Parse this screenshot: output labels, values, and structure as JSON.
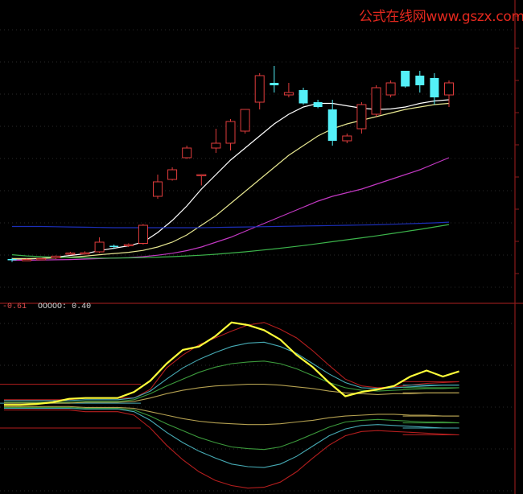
{
  "watermark": {
    "text": "公式在线网www.gszx.com.cn",
    "color": "#e3281e"
  },
  "indicator": {
    "value_1": "-0.61",
    "name": "OOOOO:",
    "value_2": "0.40"
  },
  "colors": {
    "background": "#000000",
    "up_candle": "#e03c3c",
    "down_candle": "#54f0f8",
    "frame": "#8b1a1a",
    "ma_white": "#ffffff",
    "ma_yellow": "#e6e690",
    "ma_magenta": "#c238c2",
    "ma_green": "#3cb44b",
    "ma_blue": "#1c2fb8",
    "osc_main": "#ffff3a",
    "band_red": "#b41e1e",
    "band_cyan": "#46aab4",
    "band_green": "#3c9a3c",
    "band_tan": "#b4a050"
  },
  "chart_data": [
    {
      "type": "candlestick",
      "panel": "price",
      "candles": [
        {
          "o": 6.0,
          "h": 6.5,
          "l": 4.8,
          "c": 5.5
        },
        {
          "o": 5.6,
          "h": 6.2,
          "l": 5.2,
          "c": 5.8
        },
        {
          "o": 5.8,
          "h": 6.4,
          "l": 5.5,
          "c": 6.2
        },
        {
          "o": 6.5,
          "h": 7.5,
          "l": 6.0,
          "c": 7.2
        },
        {
          "o": 8.5,
          "h": 9.0,
          "l": 7.8,
          "c": 8.5
        },
        {
          "o": 8.5,
          "h": 9.2,
          "l": 8.0,
          "c": 8.6
        },
        {
          "o": 9.0,
          "h": 15.0,
          "l": 8.5,
          "c": 13.0
        },
        {
          "o": 11.5,
          "h": 12.0,
          "l": 10.2,
          "c": 11.0
        },
        {
          "o": 11.5,
          "h": 12.5,
          "l": 11.0,
          "c": 12.0
        },
        {
          "o": 12.5,
          "h": 20.5,
          "l": 12.0,
          "c": 20.0
        },
        {
          "o": 32.0,
          "h": 41.0,
          "l": 31.0,
          "c": 38.0
        },
        {
          "o": 39.0,
          "h": 44.0,
          "l": 38.5,
          "c": 43.0
        },
        {
          "o": 48.0,
          "h": 53.0,
          "l": 47.5,
          "c": 52.0
        },
        {
          "o": 41.0,
          "h": 41.0,
          "l": 36.5,
          "c": 41.0
        },
        {
          "o": 52.0,
          "h": 60.0,
          "l": 50.0,
          "c": 54.0
        },
        {
          "o": 54.0,
          "h": 64.0,
          "l": 51.0,
          "c": 63.0
        },
        {
          "o": 59.0,
          "h": 65.0,
          "l": 58.0,
          "c": 68.0
        },
        {
          "o": 71.0,
          "h": 83.0,
          "l": 68.0,
          "c": 82.0
        },
        {
          "o": 79.0,
          "h": 86.0,
          "l": 75.0,
          "c": 78.0
        },
        {
          "o": 74.0,
          "h": 79.0,
          "l": 73.0,
          "c": 75.0
        },
        {
          "o": 76.0,
          "h": 77.0,
          "l": 70.0,
          "c": 70.5
        },
        {
          "o": 71.0,
          "h": 72.0,
          "l": 68.5,
          "c": 69.0
        },
        {
          "o": 68.0,
          "h": 72.0,
          "l": 53.0,
          "c": 55.0
        },
        {
          "o": 55.0,
          "h": 58.0,
          "l": 54.0,
          "c": 57.0
        },
        {
          "o": 60.0,
          "h": 71.0,
          "l": 58.0,
          "c": 70.0
        },
        {
          "o": 66.0,
          "h": 78.0,
          "l": 65.0,
          "c": 77.0
        },
        {
          "o": 74.0,
          "h": 80.0,
          "l": 73.0,
          "c": 79.0
        },
        {
          "o": 84.0,
          "h": 84.0,
          "l": 77.0,
          "c": 77.5
        },
        {
          "o": 82.0,
          "h": 84.0,
          "l": 75.0,
          "c": 78.0
        },
        {
          "o": 81.0,
          "h": 83.0,
          "l": 70.0,
          "c": 73.0
        },
        {
          "o": 74.0,
          "h": 80.0,
          "l": 69.0,
          "c": 79.0
        }
      ],
      "moving_averages": [
        {
          "color": "#ffffff",
          "values": [
            6,
            6,
            6.3,
            6.8,
            7.5,
            8.2,
            9.5,
            10.5,
            11.5,
            13,
            17,
            22,
            28,
            35,
            41,
            47,
            52,
            57,
            62,
            66,
            69,
            70.5,
            70.5,
            69.5,
            68.5,
            68,
            68.2,
            69,
            70.5,
            71.5,
            72
          ]
        },
        {
          "color": "#e6e690",
          "values": [
            6.2,
            6.2,
            6.3,
            6.5,
            6.8,
            7.2,
            7.8,
            8.3,
            8.8,
            9.6,
            11,
            13,
            16,
            20,
            24,
            29,
            34,
            39,
            44,
            49,
            53,
            57,
            60,
            62,
            63.5,
            65,
            66.5,
            68,
            69,
            70,
            70.5
          ]
        },
        {
          "color": "#c238c2",
          "values": [
            5.5,
            5.5,
            5.6,
            5.7,
            5.8,
            6,
            6.2,
            6.4,
            6.6,
            7,
            7.6,
            8.4,
            9.5,
            11,
            13,
            15,
            17.5,
            20,
            22.5,
            25,
            27.5,
            30,
            32,
            33.5,
            35,
            37,
            39,
            41,
            43,
            45.5,
            48
          ]
        },
        {
          "color": "#3cb44b",
          "values": [
            7.8,
            7.3,
            7,
            6.8,
            6.6,
            6.5,
            6.4,
            6.4,
            6.5,
            6.6,
            6.8,
            7,
            7.3,
            7.6,
            8,
            8.5,
            9,
            9.6,
            10.2,
            10.9,
            11.6,
            12.4,
            13.2,
            14,
            14.8,
            15.6,
            16.5,
            17.4,
            18.3,
            19.3,
            20.3
          ]
        },
        {
          "color": "#1c2fb8",
          "values": [
            19.5,
            19.5,
            19.5,
            19.4,
            19.3,
            19.2,
            19.1,
            19,
            19,
            19,
            19,
            19,
            19,
            19,
            19.1,
            19.2,
            19.3,
            19.4,
            19.5,
            19.6,
            19.7,
            19.8,
            19.9,
            20,
            20.1,
            20.2,
            20.4,
            20.6,
            20.8,
            21,
            21.3
          ]
        }
      ]
    },
    {
      "type": "line",
      "panel": "oscillator",
      "series": [
        {
          "role": "main",
          "color": "#ffff3a",
          "values": [
            -0.08,
            -0.08,
            -0.07,
            -0.05,
            -0.01,
            0.0,
            0.0,
            0.0,
            0.07,
            0.2,
            0.4,
            0.56,
            0.6,
            0.72,
            0.88,
            0.85,
            0.79,
            0.68,
            0.5,
            0.36,
            0.18,
            0.02,
            0.07,
            0.1,
            0.14,
            0.25,
            0.32,
            0.25,
            0.31
          ]
        },
        {
          "role": "band-upper",
          "color": "#b41e1e",
          "values": [
            -0.02,
            -0.02,
            -0.02,
            -0.02,
            -0.02,
            0.0,
            0.0,
            0.0,
            0.0,
            0.1,
            0.35,
            0.5,
            0.62,
            0.7,
            0.78,
            0.85,
            0.88,
            0.8,
            0.7,
            0.55,
            0.38,
            0.22,
            0.14,
            0.12,
            0.13,
            0.15,
            0.17,
            0.18,
            0.19
          ]
        },
        {
          "role": "band-upper",
          "color": "#46aab4",
          "values": [
            -0.03,
            -0.03,
            -0.03,
            -0.03,
            -0.03,
            -0.02,
            -0.02,
            -0.02,
            0.0,
            0.08,
            0.22,
            0.35,
            0.45,
            0.53,
            0.6,
            0.64,
            0.65,
            0.6,
            0.52,
            0.4,
            0.28,
            0.18,
            0.12,
            0.11,
            0.12,
            0.13,
            0.14,
            0.15,
            0.15
          ]
        },
        {
          "role": "band-upper",
          "color": "#3c9a3c",
          "values": [
            -0.05,
            -0.05,
            -0.05,
            -0.05,
            -0.05,
            -0.04,
            -0.04,
            -0.04,
            -0.02,
            0.05,
            0.14,
            0.22,
            0.3,
            0.36,
            0.4,
            0.42,
            0.43,
            0.4,
            0.34,
            0.26,
            0.18,
            0.12,
            0.09,
            0.08,
            0.09,
            0.1,
            0.11,
            0.11,
            0.12
          ]
        },
        {
          "role": "band-upper",
          "color": "#b4a050",
          "values": [
            -0.06,
            -0.06,
            -0.06,
            -0.06,
            -0.06,
            -0.05,
            -0.05,
            -0.05,
            -0.04,
            0.0,
            0.05,
            0.09,
            0.12,
            0.14,
            0.15,
            0.16,
            0.16,
            0.15,
            0.13,
            0.11,
            0.08,
            0.06,
            0.05,
            0.04,
            0.05,
            0.05,
            0.06,
            0.06,
            0.06
          ]
        },
        {
          "role": "band-lower",
          "color": "#b4a050",
          "values": [
            -0.1,
            -0.1,
            -0.1,
            -0.1,
            -0.1,
            -0.11,
            -0.11,
            -0.11,
            -0.12,
            -0.16,
            -0.2,
            -0.24,
            -0.27,
            -0.29,
            -0.3,
            -0.31,
            -0.31,
            -0.3,
            -0.28,
            -0.26,
            -0.23,
            -0.21,
            -0.2,
            -0.19,
            -0.19,
            -0.2,
            -0.2,
            -0.21,
            -0.21
          ]
        },
        {
          "role": "band-lower",
          "color": "#3c9a3c",
          "values": [
            -0.11,
            -0.11,
            -0.11,
            -0.11,
            -0.11,
            -0.12,
            -0.12,
            -0.12,
            -0.14,
            -0.21,
            -0.3,
            -0.38,
            -0.46,
            -0.52,
            -0.57,
            -0.59,
            -0.6,
            -0.57,
            -0.5,
            -0.42,
            -0.34,
            -0.28,
            -0.26,
            -0.25,
            -0.26,
            -0.27,
            -0.28,
            -0.28,
            -0.29
          ]
        },
        {
          "role": "band-lower",
          "color": "#46aab4",
          "values": [
            -0.12,
            -0.12,
            -0.12,
            -0.12,
            -0.12,
            -0.13,
            -0.13,
            -0.13,
            -0.16,
            -0.26,
            -0.4,
            -0.52,
            -0.62,
            -0.7,
            -0.77,
            -0.8,
            -0.81,
            -0.77,
            -0.68,
            -0.56,
            -0.44,
            -0.36,
            -0.32,
            -0.31,
            -0.32,
            -0.33,
            -0.34,
            -0.35,
            -0.35
          ]
        },
        {
          "role": "band-lower",
          "color": "#b41e1e",
          "values": [
            -0.14,
            -0.14,
            -0.14,
            -0.14,
            -0.14,
            -0.16,
            -0.16,
            -0.16,
            -0.2,
            -0.35,
            -0.55,
            -0.72,
            -0.86,
            -0.96,
            -1.02,
            -1.05,
            -1.04,
            -0.98,
            -0.86,
            -0.7,
            -0.55,
            -0.44,
            -0.39,
            -0.38,
            -0.39,
            -0.4,
            -0.41,
            -0.42,
            -0.43
          ]
        }
      ],
      "horizontal_levels": [
        {
          "color": "#b41e1e",
          "y": 0.16
        },
        {
          "color": "#b41e1e",
          "y": -0.35
        },
        {
          "color": "#46aab4",
          "y": -0.06
        }
      ],
      "ylim": [
        -1.1,
        1.0
      ]
    }
  ]
}
